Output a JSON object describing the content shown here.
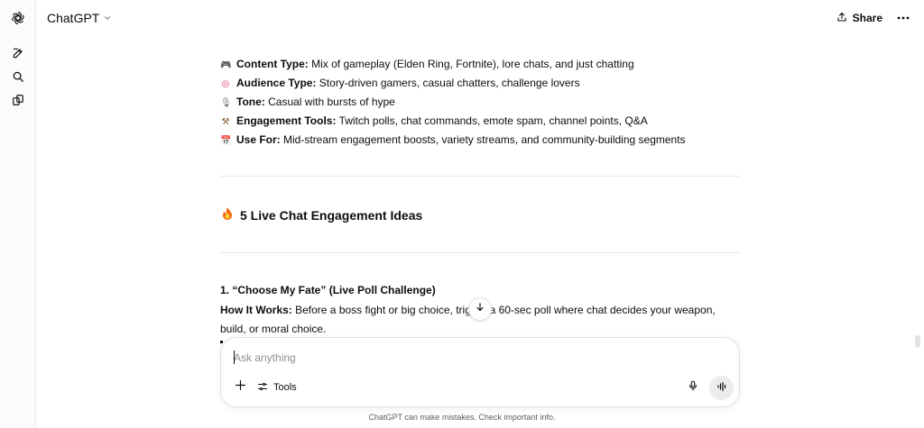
{
  "topbar": {
    "model_label": "ChatGPT",
    "share_label": "Share"
  },
  "meta": [
    {
      "icon": "game-controller-icon",
      "glyph": "🎮",
      "color": "#7b3fd1",
      "label": "Content Type:",
      "text": " Mix of gameplay (Elden Ring, Fortnite), lore chats, and just chatting"
    },
    {
      "icon": "target-icon",
      "glyph": "◎",
      "color": "#d6336c",
      "label": "Audience Type:",
      "text": " Story-driven gamers, casual chatters, challenge lovers"
    },
    {
      "icon": "microphone-icon",
      "glyph": "🎙",
      "color": "#6b6b6b",
      "label": "Tone:",
      "text": " Casual with bursts of hype"
    },
    {
      "icon": "tools-icon",
      "glyph": "⚒",
      "color": "#8a5a2b",
      "label": "Engagement Tools:",
      "text": " Twitch polls, chat commands, emote spam, channel points, Q&A"
    },
    {
      "icon": "calendar-icon",
      "glyph": "📅",
      "color": "#3b6fb6",
      "label": "Use For:",
      "text": " Mid-stream engagement boosts, variety streams, and community-building segments"
    }
  ],
  "section": {
    "icon": "fire-icon",
    "title": "5 Live Chat Engagement Ideas"
  },
  "idea1": {
    "title": "1. “Choose My Fate” (Live Poll Challenge)",
    "how_label": "How It Works:",
    "how_text": " Before a boss fight or big choice, trigger a 60-sec poll where chat decides your weapon, build, or moral choice."
  },
  "composer": {
    "placeholder": "Ask anything",
    "tools_label": "Tools"
  },
  "footer": {
    "note": "ChatGPT can make mistakes. Check important info."
  }
}
